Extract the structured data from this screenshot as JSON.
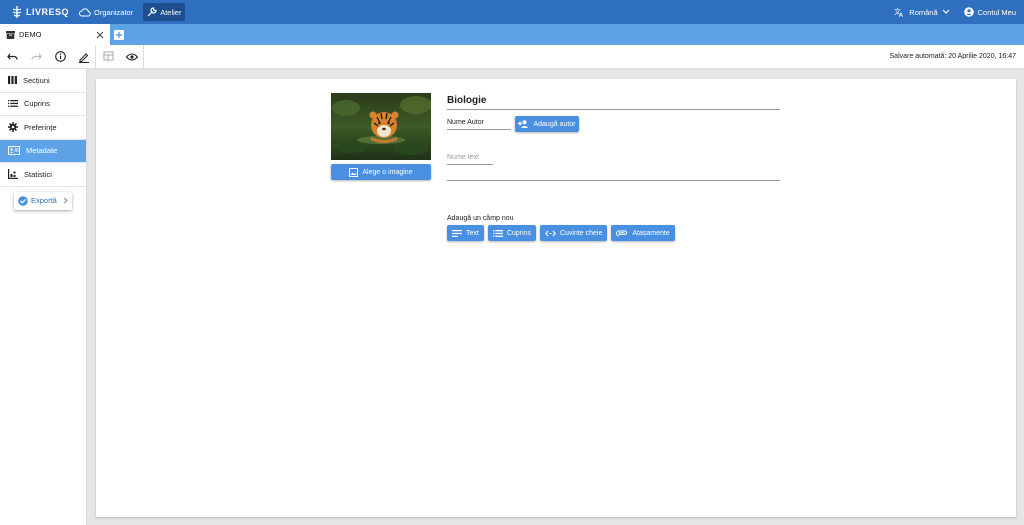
{
  "app": {
    "logo_text": "LIVRESQ",
    "nav": [
      {
        "label": "Organizator",
        "icon": "cloud-icon"
      },
      {
        "label": "Atelier",
        "icon": "wrench-icon"
      }
    ],
    "language": "Română",
    "account": "Contul Meu"
  },
  "tab": {
    "label": "DEMO"
  },
  "toolbar": {
    "autosave": "Salvare automată: 20 Aprilie 2020, 16:47"
  },
  "sidebar": {
    "items": [
      {
        "label": "Secțiuni",
        "icon": "sections-icon"
      },
      {
        "label": "Cuprins",
        "icon": "toc-icon"
      },
      {
        "label": "Preferințe",
        "icon": "gear-icon"
      },
      {
        "label": "Metadate",
        "icon": "metadata-icon",
        "active": true
      },
      {
        "label": "Statistici",
        "icon": "stats-icon"
      }
    ],
    "export_label": "Exportă"
  },
  "main": {
    "title": "Biologie",
    "choose_image_label": "Alege o imagine",
    "author_placeholder": "Nume Autor",
    "add_author_label": "Adaugă autor",
    "text_name_placeholder": "Nume text",
    "add_field_label": "Adaugă un câmp nou",
    "field_buttons": [
      {
        "label": "Text",
        "icon": "text-lines-icon"
      },
      {
        "label": "Cuprins",
        "icon": "toc-icon"
      },
      {
        "label": "Cuvinte cheie",
        "icon": "code-tags-icon"
      },
      {
        "label": "Atașamente",
        "icon": "attachment-icon"
      }
    ]
  },
  "colors": {
    "topbar": "#2f6fbf",
    "tabbar": "#5ea3e8",
    "button": "#4a90e2",
    "active_sidebar": "#5ea3e8"
  }
}
